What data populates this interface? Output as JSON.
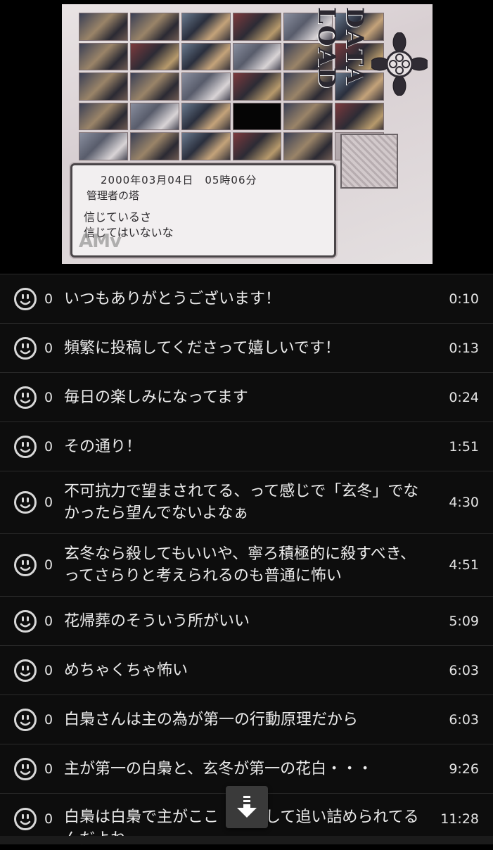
{
  "player": {
    "frame_title": "DATA LOAD",
    "date_line": "2000年03月04日　05時06分",
    "location": "管理者の塔",
    "line1": "信じているさ",
    "line2": "信じてはいないな",
    "watermark": "AMv"
  },
  "comments": [
    {
      "count": "0",
      "text": "いつもありがとうございます！",
      "time": "0:10"
    },
    {
      "count": "0",
      "text": "頻繁に投稿してくださって嬉しいです！",
      "time": "0:13"
    },
    {
      "count": "0",
      "text": "毎日の楽しみになってます",
      "time": "0:24"
    },
    {
      "count": "0",
      "text": "その通り！",
      "time": "1:51"
    },
    {
      "count": "0",
      "text": "不可抗力で望まされてる、って感じで「玄冬」でなかったら望んでないよなぁ",
      "time": "4:30"
    },
    {
      "count": "0",
      "text": "玄冬なら殺してもいいや、寧ろ積極的に殺すべき、ってさらりと考えられるのも普通に怖い",
      "time": "4:51"
    },
    {
      "count": "0",
      "text": "花帰葬のそういう所がいい",
      "time": "5:09"
    },
    {
      "count": "0",
      "text": "めちゃくちゃ怖い",
      "time": "6:03"
    },
    {
      "count": "0",
      "text": "白梟さんは主の為が第一の行動原理だから",
      "time": "6:03"
    },
    {
      "count": "0",
      "text": "主が第一の白梟と、玄冬が第一の花白・・・",
      "time": "9:26"
    },
    {
      "count": "0",
      "text": "白梟は白梟で主がここ　　放して追い詰められてるんだよね",
      "time": "11:28"
    }
  ]
}
